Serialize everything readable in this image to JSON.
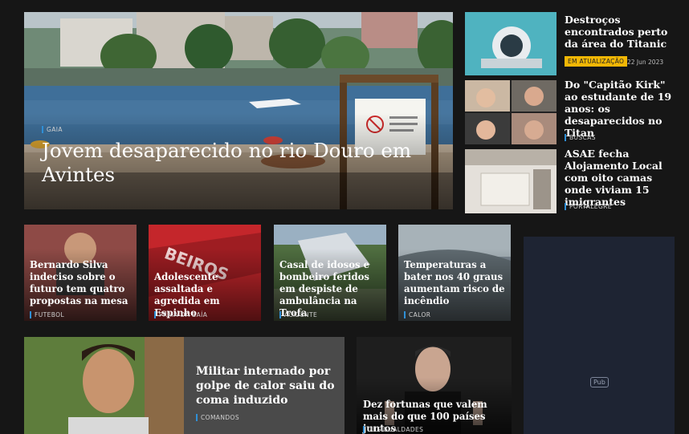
{
  "hero": {
    "category": "GAIA",
    "title": "Jovem desaparecido no rio Douro em Avintes"
  },
  "side": [
    {
      "title": "Destroços encontrados perto da área do Titanic",
      "badge": "EM ATUALIZAÇÃO",
      "date": "22 Jun 2023"
    },
    {
      "title": "Do \"Capitão Kirk\" ao estudante de 19 anos: os desaparecidos no Titan",
      "category": "BUSCAS"
    },
    {
      "title": "ASAE fecha Alojamento Local com oito camas onde viviam 15 imigrantes",
      "category": "PORTALEGRE"
    }
  ],
  "grid": [
    {
      "title": "Bernardo Silva indeciso sobre o futuro tem quatro propostas na mesa",
      "category": "FUTEBOL"
    },
    {
      "title": "Adolescente assaltada e agredida em Espinho",
      "category": "PRAIA DA BAÍA"
    },
    {
      "title": "Casal de idosos e bombeiro feridos em despiste de ambulância na Trofa",
      "category": "ACIDENTE"
    },
    {
      "title": "Temperaturas a bater nos 40 graus aumentam risco de incêndio",
      "category": "CALOR"
    }
  ],
  "bottom": [
    {
      "title": "Militar internado por golpe de calor saiu do coma induzido",
      "category": "COMANDOS"
    },
    {
      "title": "Dez fortunas que valem mais do que 100 países juntos",
      "category": "DESIGUALDADES"
    }
  ],
  "ad": {
    "label": "Pub"
  },
  "colors": {
    "accent": "#2f8fd6",
    "badge": "#f2b705",
    "background": "#161616"
  }
}
